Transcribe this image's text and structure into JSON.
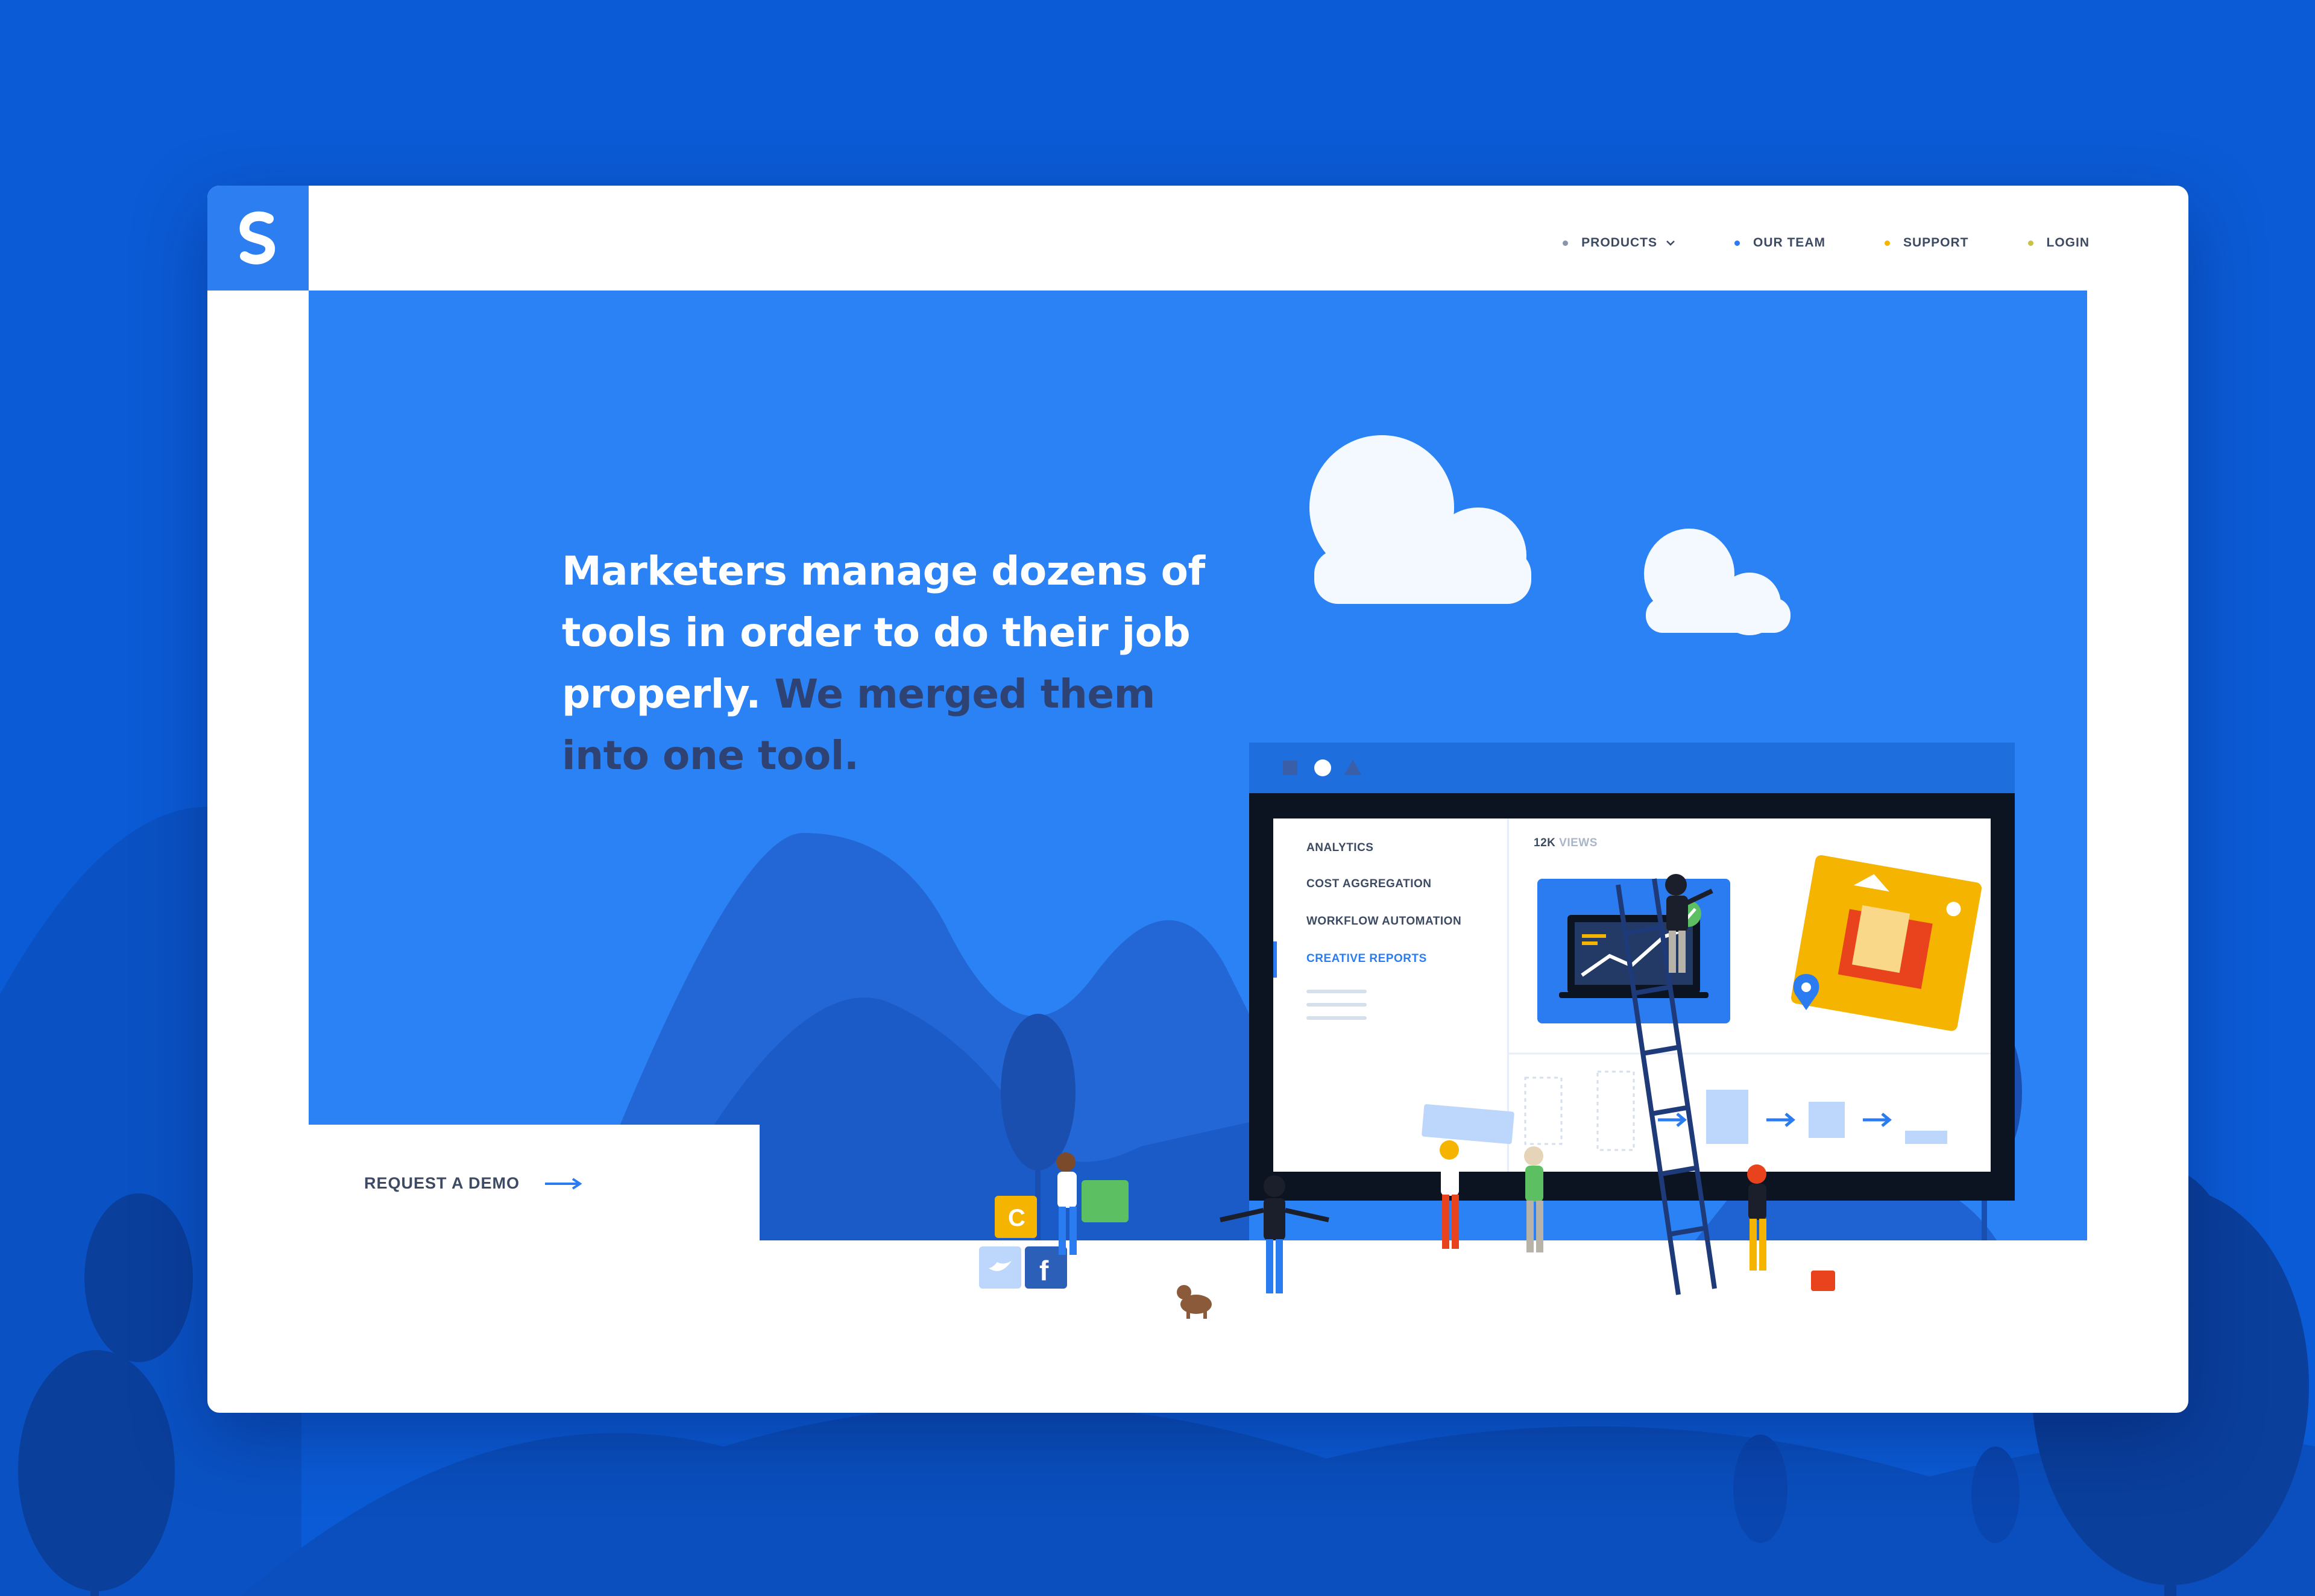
{
  "brand": {
    "logo_icon": "s-logo-icon",
    "accent_color": "#2b82f4",
    "page_background": "#0b5bd6"
  },
  "nav": {
    "items": [
      {
        "label": "PRODUCTS",
        "dot_color": "#8a97ab",
        "has_dropdown": true
      },
      {
        "label": "OUR TEAM",
        "dot_color": "#2b7cf0",
        "has_dropdown": false
      },
      {
        "label": "SUPPORT",
        "dot_color": "#f5b400",
        "has_dropdown": false
      },
      {
        "label": "LOGIN",
        "dot_color": "#c9c24a",
        "has_dropdown": false
      }
    ]
  },
  "hero": {
    "headline_light": "Marketers manage dozens of tools in order to do their job properly.",
    "headline_dark": "We merged them into one tool.",
    "cta_label": "REQUEST A DEMO"
  },
  "dashboard": {
    "menu": [
      {
        "label": "ANALYTICS",
        "active": false
      },
      {
        "label": "COST AGGREGATION",
        "active": false
      },
      {
        "label": "WORKFLOW AUTOMATION",
        "active": false
      },
      {
        "label": "CREATIVE REPORTS",
        "active": true
      }
    ],
    "views_value": "12K",
    "views_label": "VIEWS"
  }
}
